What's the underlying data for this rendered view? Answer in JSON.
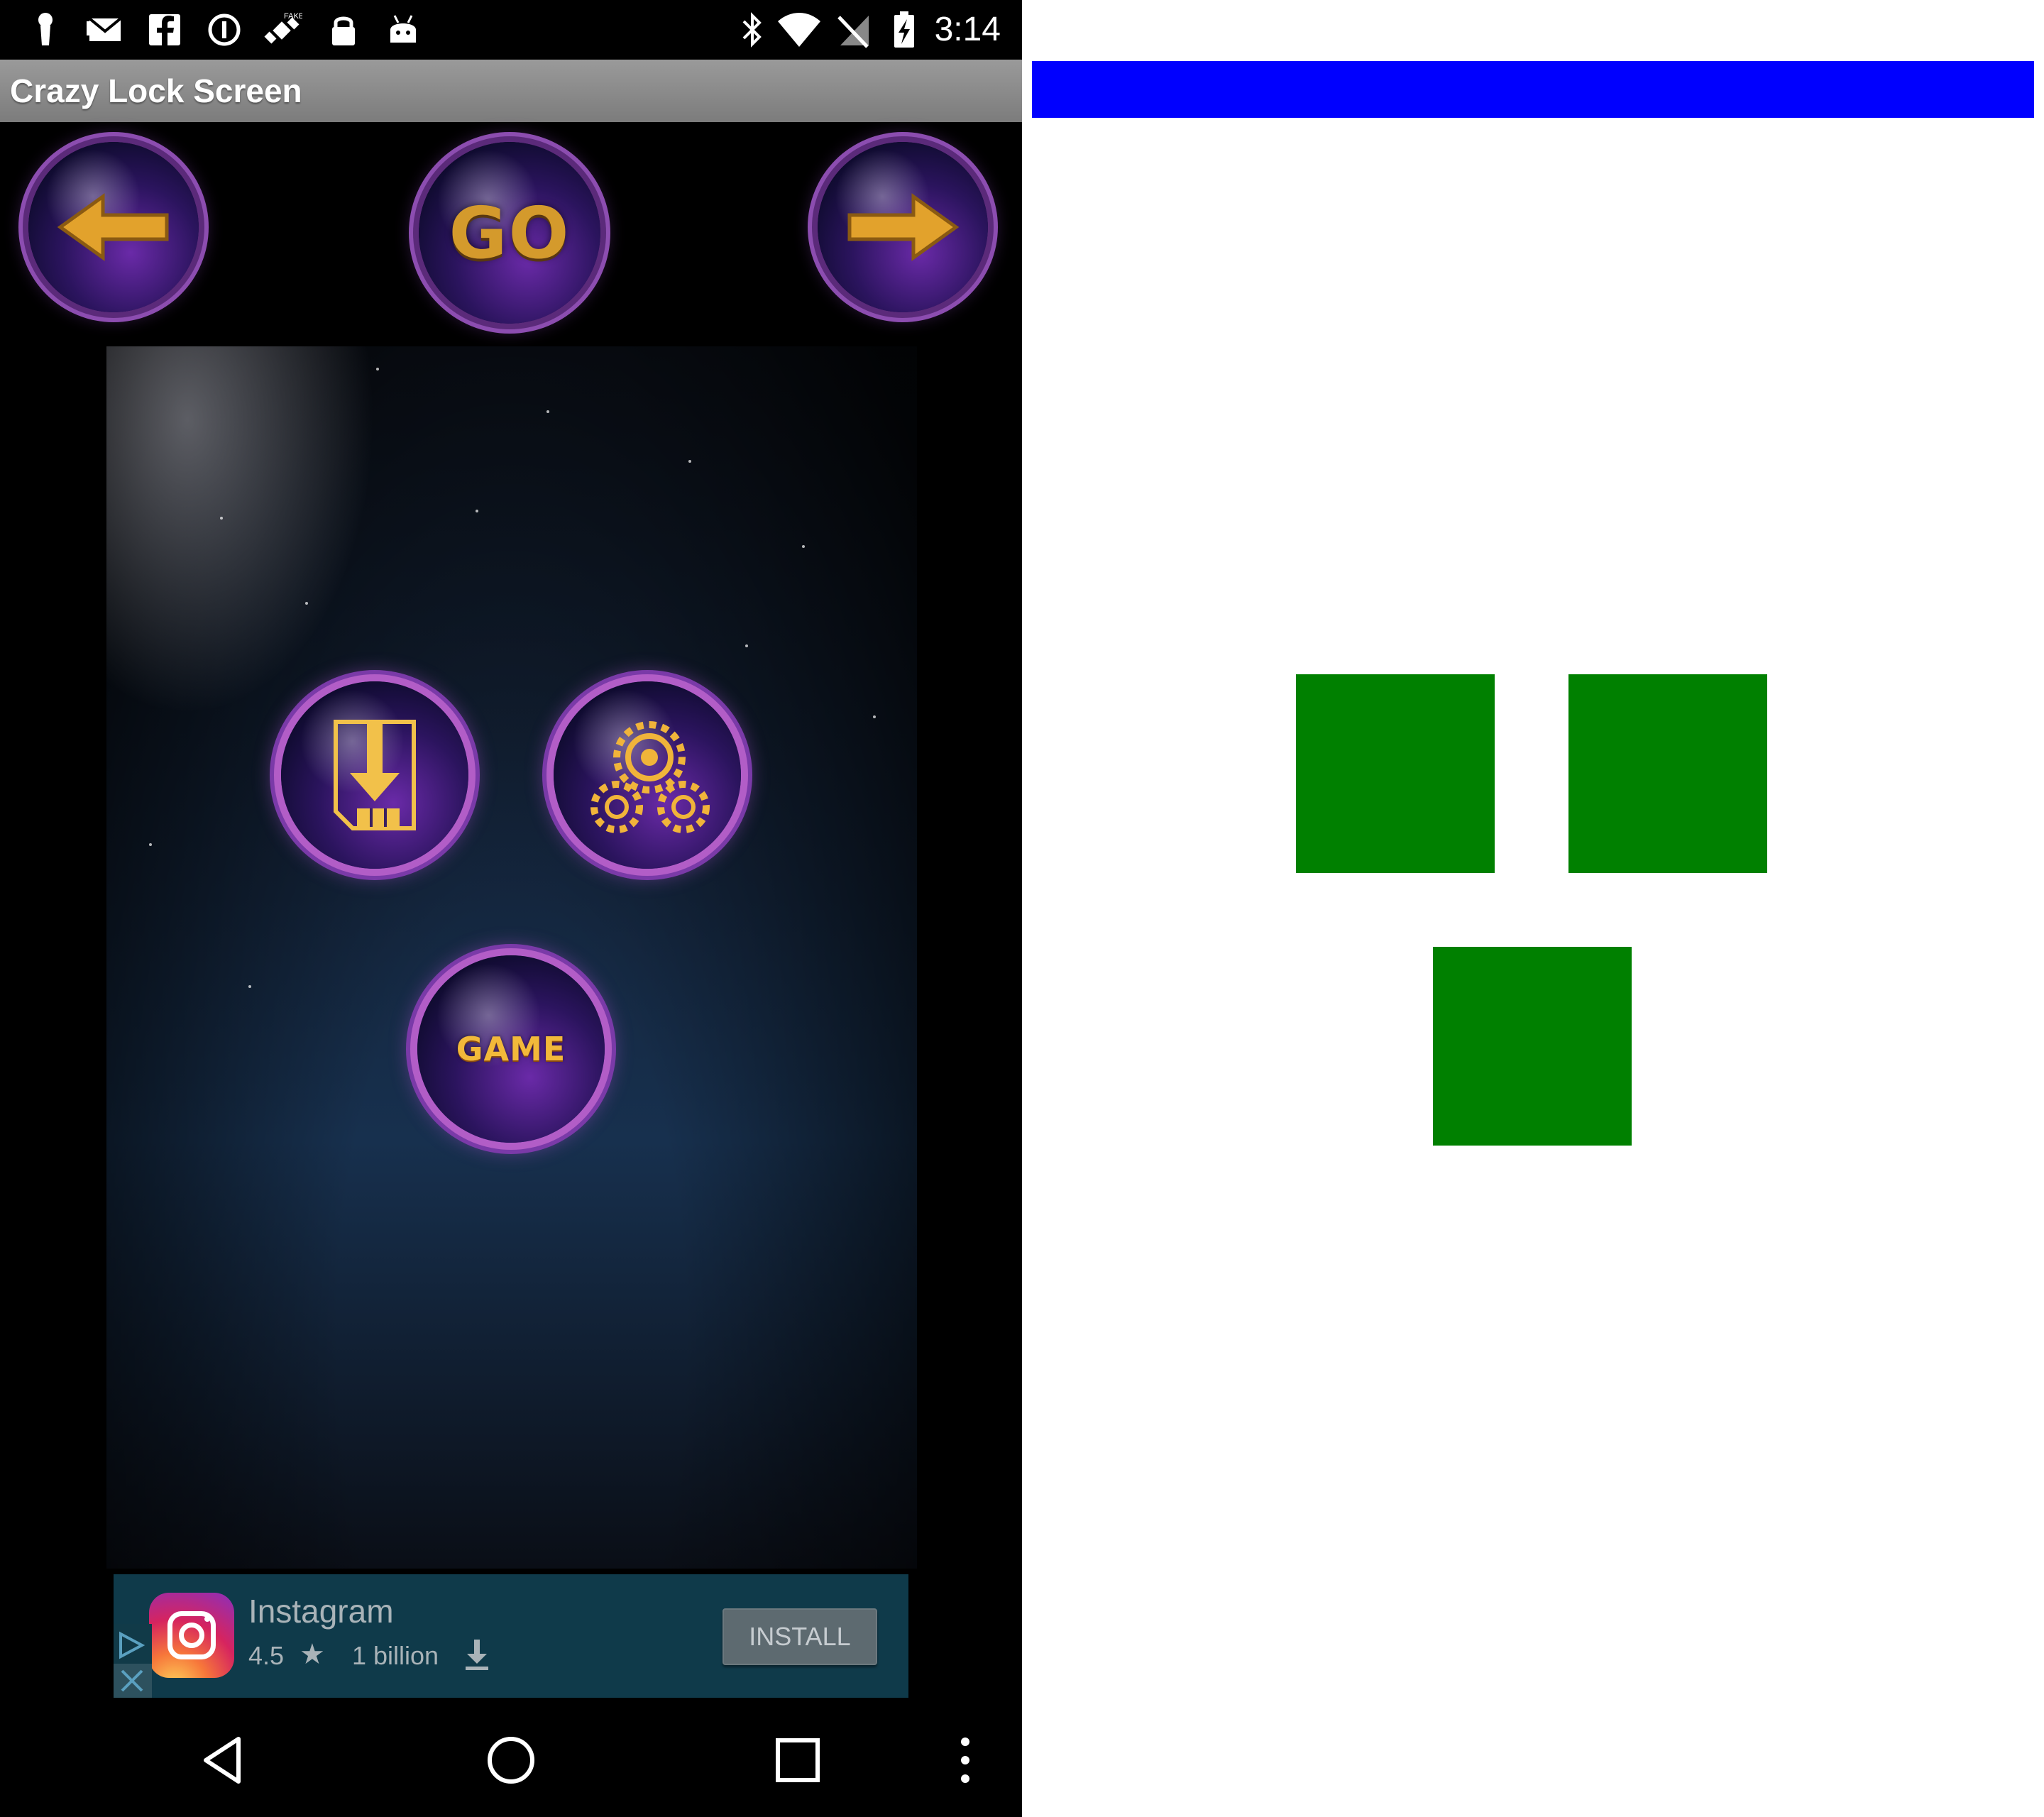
{
  "status_bar": {
    "time": "3:14",
    "left_icons": [
      "keyhole-icon",
      "email-icon",
      "facebook-icon",
      "info-icon",
      "fake-gps-icon",
      "lock-icon",
      "android-icon"
    ],
    "right_icons": [
      "bluetooth-icon",
      "wifi-icon",
      "no-sim-icon",
      "battery-charging-icon"
    ]
  },
  "app": {
    "title": "Crazy Lock Screen"
  },
  "top_buttons": {
    "back": "arrow-left-icon",
    "go_label": "GO",
    "forward": "arrow-right-icon"
  },
  "menu_buttons": {
    "download": "download-icon",
    "settings": "gears-icon",
    "game_label": "GAME"
  },
  "ad": {
    "app_name": "Instagram",
    "rating": "4.5",
    "installs": "1 billion",
    "install_label": "INSTALL",
    "icons": [
      "instagram-logo",
      "star-icon",
      "download-icon",
      "adchoices-icon",
      "close-icon"
    ]
  },
  "nav_bar": {
    "icons": [
      "back-triangle-icon",
      "home-circle-icon",
      "recents-square-icon",
      "overflow-menu-icon"
    ]
  },
  "wireframe": {
    "bar_color": "#0000ff",
    "box_color": "#008000",
    "box_count": 3
  },
  "colors": {
    "title_bar": "#8a8a8a",
    "ad_background": "#0f3a4a",
    "gold": "#f2b93a",
    "orb_ring": "#b25dc7"
  }
}
